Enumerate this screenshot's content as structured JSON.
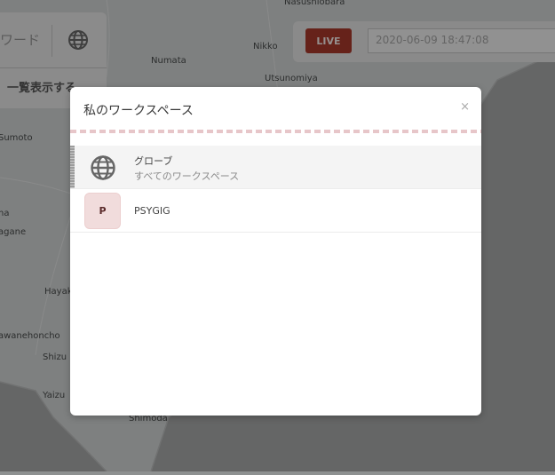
{
  "map": {
    "places": [
      {
        "name": "Nasushiobara"
      },
      {
        "name": "Nikko"
      },
      {
        "name": "Numata"
      },
      {
        "name": "Utsunomiya"
      },
      {
        "name": "Sumoto"
      },
      {
        "name": "na"
      },
      {
        "name": "agane"
      },
      {
        "name": "Hayak"
      },
      {
        "name": "awanehoncho"
      },
      {
        "name": "Shizu"
      },
      {
        "name": "Yaizu"
      },
      {
        "name": "Shimoda"
      }
    ]
  },
  "left_panel": {
    "keyword_text": "ワード",
    "list_button_label": "一覧表示する"
  },
  "live_bar": {
    "live_label": "LIVE",
    "datetime_value": "2020-06-09 18:47:08",
    "live_color": "#8d2012"
  },
  "modal": {
    "title": "私のワークスペース",
    "close_label": "×",
    "workspaces": [
      {
        "icon": "globe-icon",
        "name": "グローブ",
        "subtitle": "すべてのワークスペース",
        "selected": true
      },
      {
        "avatar_letter": "P",
        "name": "PSYGIG",
        "selected": false
      }
    ]
  },
  "colors": {
    "overlay": "#5e6060",
    "dash_accent": "#e7c6c9",
    "avatar_bg": "#f1dcdc"
  }
}
